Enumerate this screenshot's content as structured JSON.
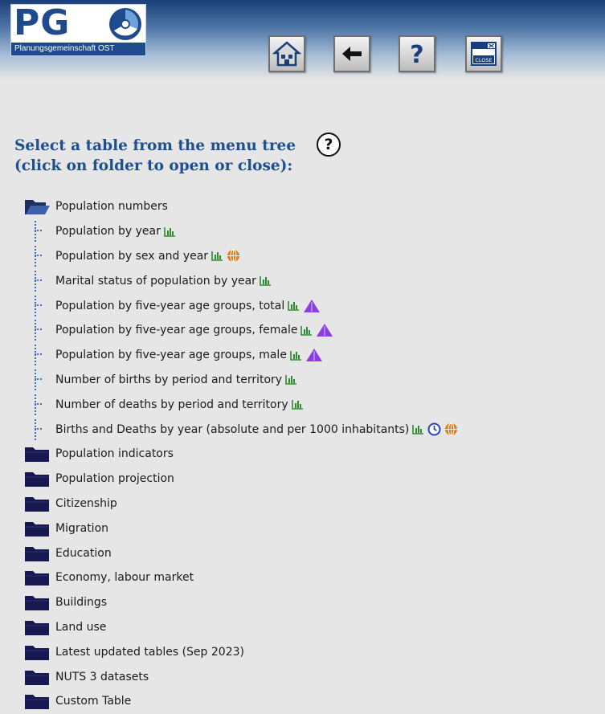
{
  "header": {
    "logo_letters": "PG",
    "logo_subtitle": "Planungsgemeinschaft OST",
    "buttons": [
      {
        "name": "home",
        "icon": "home-icon"
      },
      {
        "name": "back",
        "icon": "back-arrow-icon"
      },
      {
        "name": "help",
        "icon": "question-icon",
        "label": "?"
      },
      {
        "name": "close",
        "icon": "close-window-icon",
        "label": "CLOSE"
      }
    ]
  },
  "heading": {
    "line1": "Select a table from the menu tree",
    "line2": "(click on folder to open or close):",
    "help_label": "?"
  },
  "colors": {
    "heading": "#1d4f93",
    "header_dark": "#1a3f78",
    "chart_icon": "#2e8b2e",
    "pyramid_icon": "#8a3fe0",
    "globe_icon": "#e8780f",
    "clock_icon": "#2c3fc9"
  },
  "tree": {
    "open_folder": {
      "label": "Population numbers",
      "items": [
        {
          "label": "Population by year",
          "icons": [
            "bar-chart-icon"
          ]
        },
        {
          "label": "Population by sex and year",
          "icons": [
            "bar-chart-icon",
            "globe-icon"
          ]
        },
        {
          "label": "Marital status of population by year",
          "icons": [
            "bar-chart-icon"
          ]
        },
        {
          "label": "Population by five-year age groups, total",
          "icons": [
            "bar-chart-icon",
            "pyramid-icon"
          ]
        },
        {
          "label": "Population by five-year age groups, female",
          "icons": [
            "bar-chart-icon",
            "pyramid-icon"
          ]
        },
        {
          "label": "Population by five-year age groups, male",
          "icons": [
            "bar-chart-icon",
            "pyramid-icon"
          ]
        },
        {
          "label": "Number of births by period and territory",
          "icons": [
            "bar-chart-icon"
          ]
        },
        {
          "label": "Number of deaths by period and territory",
          "icons": [
            "bar-chart-icon"
          ]
        },
        {
          "label": "Births and Deaths by year (absolute and per 1000 inhabitants)",
          "icons": [
            "bar-chart-icon",
            "clock-icon",
            "globe-icon"
          ]
        }
      ]
    },
    "closed_folders": [
      "Population indicators",
      "Population projection",
      "Citizenship",
      "Migration",
      "Education",
      "Economy, labour market",
      "Buildings",
      "Land use",
      "Latest updated tables (Sep 2023)",
      "NUTS 3 datasets",
      "Custom Table"
    ]
  }
}
